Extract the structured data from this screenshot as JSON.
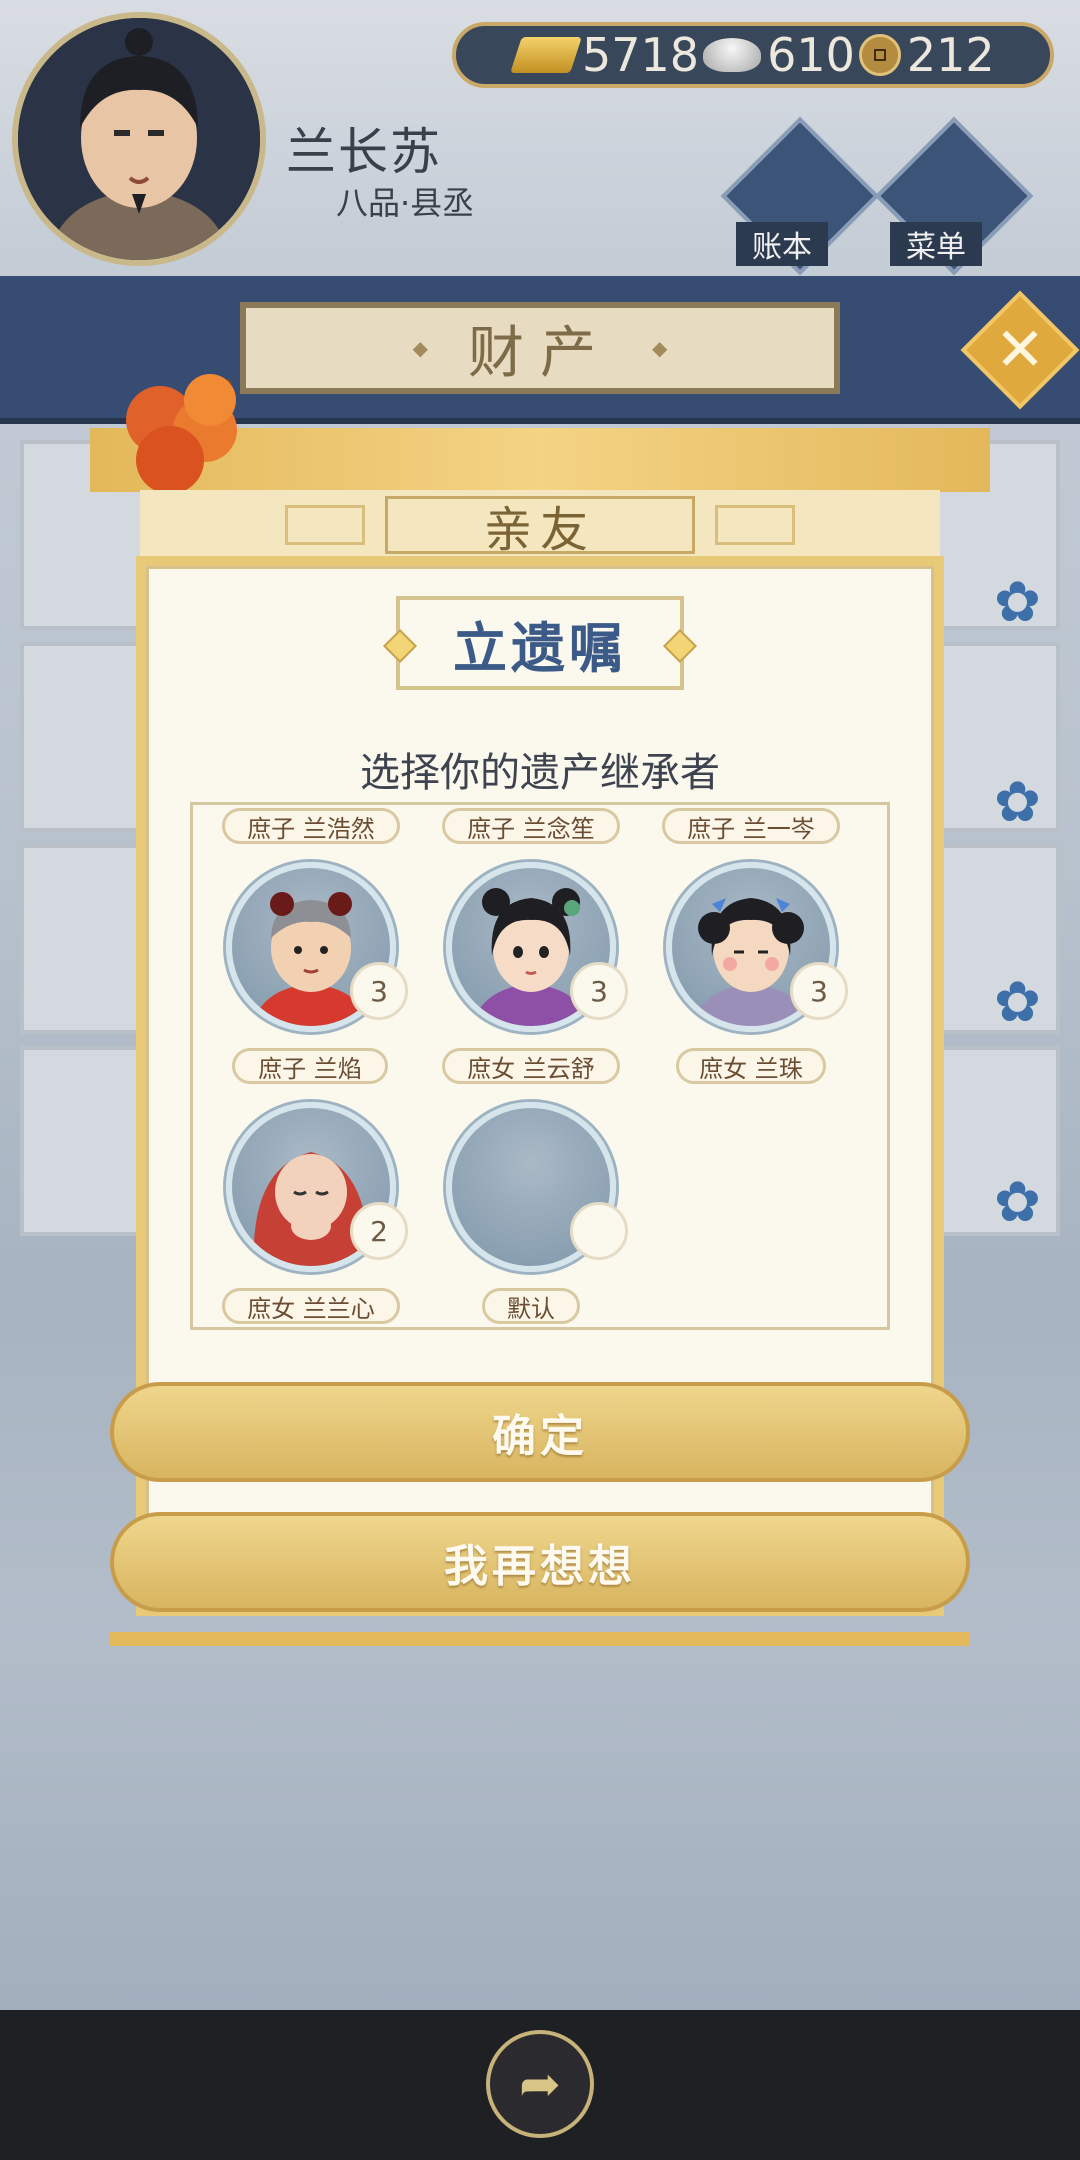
{
  "player": {
    "name": "兰长苏",
    "rank": "八品·县丞"
  },
  "currency": {
    "gold": "5718",
    "silver": "610",
    "coin": "212"
  },
  "hud": {
    "ledger_label": "账本",
    "menu_label": "菜单"
  },
  "header": {
    "title": "财产"
  },
  "modal": {
    "tab_label": "亲友",
    "title": "立遗嘱",
    "subtitle": "选择你的遗产继承者",
    "top_tags": [
      "庶子 兰浩然",
      "庶子 兰念笙",
      "庶子 兰一岑"
    ],
    "heirs": [
      {
        "label": "庶子 兰焰",
        "badge": "3"
      },
      {
        "label": "庶女 兰云舒",
        "badge": "3"
      },
      {
        "label": "庶女 兰珠",
        "badge": "3"
      },
      {
        "label": "庶女 兰兰心",
        "badge": "2"
      },
      {
        "label": "默认",
        "badge": ""
      }
    ],
    "confirm_label": "确定",
    "cancel_label": "我再想想"
  },
  "colors": {
    "accent_blue": "#3c5a88",
    "gold": "#e3b85a",
    "band": "#364c72"
  },
  "icons": {
    "close": "close-icon",
    "share": "share-icon"
  }
}
